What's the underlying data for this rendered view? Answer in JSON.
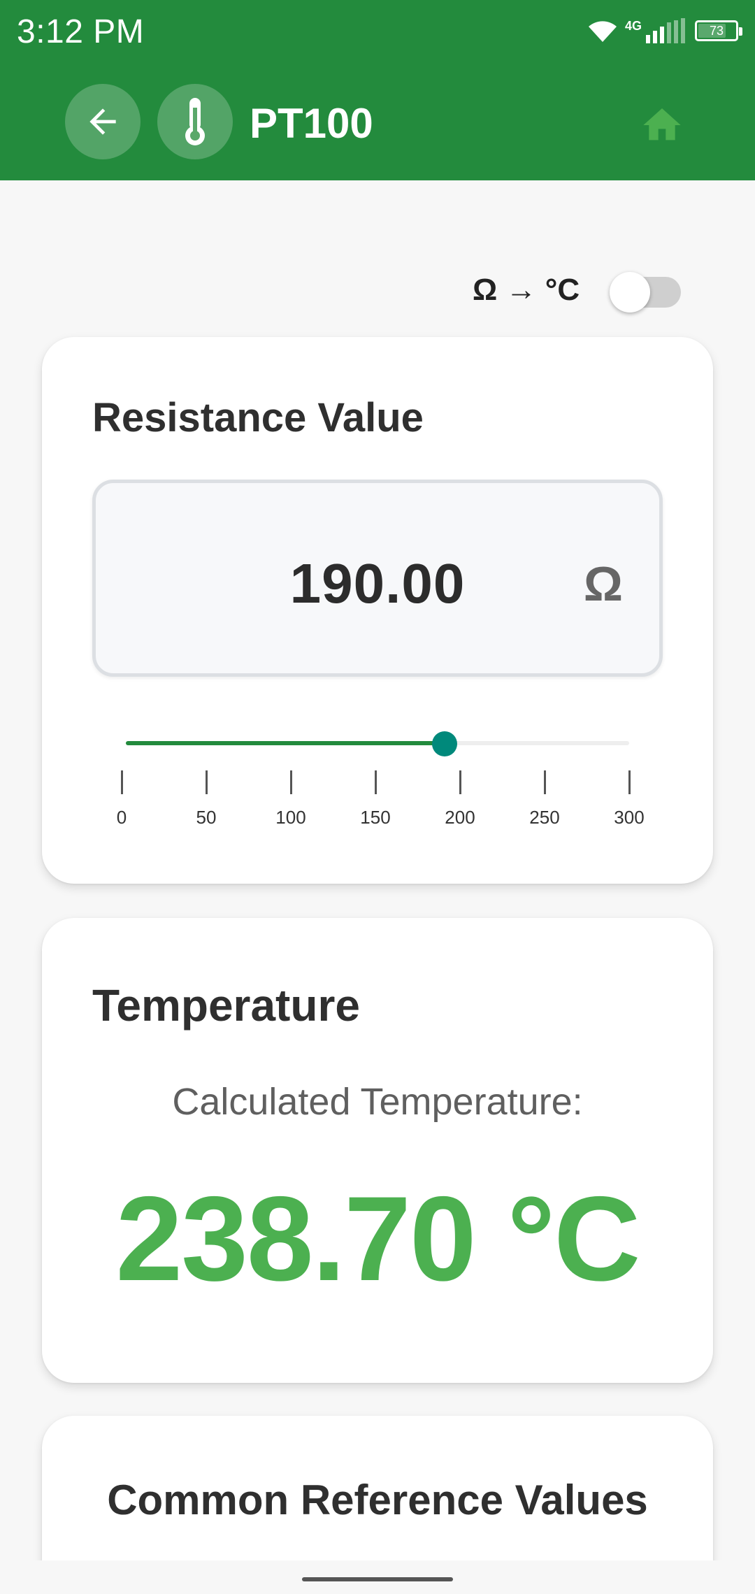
{
  "status_bar": {
    "time": "3:12 PM",
    "network": "4G",
    "battery": "73"
  },
  "app_bar": {
    "title": "PT100",
    "back_icon": "arrow-left-icon",
    "app_icon": "thermometer-icon",
    "home_icon": "home-icon"
  },
  "mode_toggle": {
    "label": "Ω → °C",
    "on": false
  },
  "resistance_card": {
    "title": "Resistance Value",
    "value": "190.00",
    "unit": "Ω",
    "slider": {
      "min": 0,
      "max": 300,
      "value": 190
    },
    "ticks": [
      "0",
      "50",
      "100",
      "150",
      "200",
      "250",
      "300"
    ]
  },
  "temperature_card": {
    "title": "Temperature",
    "label": "Calculated Temperature:",
    "value": "238.70 °C"
  },
  "reference_card": {
    "title": "Common Reference Values"
  },
  "colors": {
    "primary": "#238b3d",
    "accent_green": "#4cb050",
    "slider_thumb": "#00897b",
    "home_icon": "#4cb050"
  }
}
